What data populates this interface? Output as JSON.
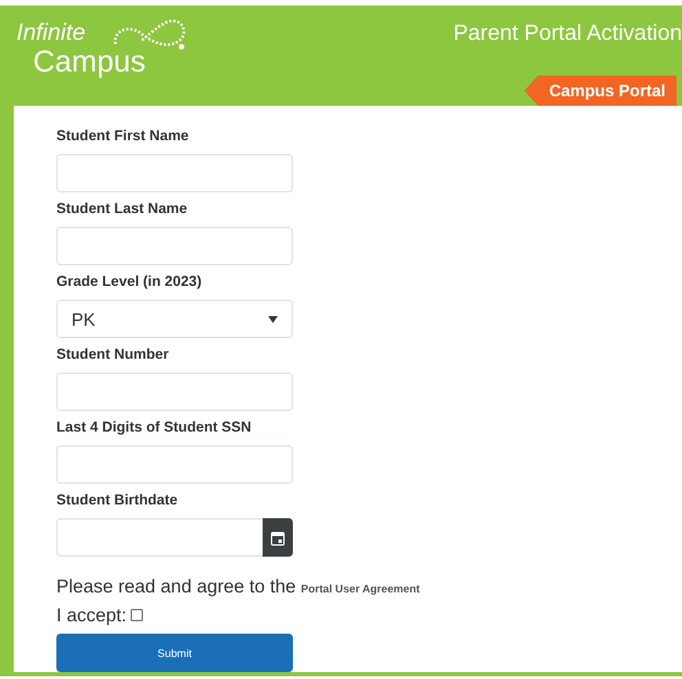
{
  "header": {
    "logo": {
      "line_1": "Infinite",
      "line_2": "Campus"
    },
    "title": "Parent Portal Activation",
    "tab": "Campus Portal"
  },
  "fields": [
    {
      "kind": "text",
      "label": "Student First Name"
    },
    {
      "kind": "text",
      "label": "Student Last Name"
    },
    {
      "kind": "select",
      "label": "Grade Level (in 2023)",
      "value": "PK"
    },
    {
      "kind": "text",
      "label": "Student Number"
    },
    {
      "kind": "text",
      "label": "Last 4 Digits of Student SSN"
    },
    {
      "kind": "date",
      "label": "Student Birthdate"
    }
  ],
  "agreement": {
    "text": "Please read and agree to the",
    "link": "Portal User Agreement"
  },
  "accept": {
    "label": "I accept:",
    "checked": false
  },
  "submit": "Submit"
}
